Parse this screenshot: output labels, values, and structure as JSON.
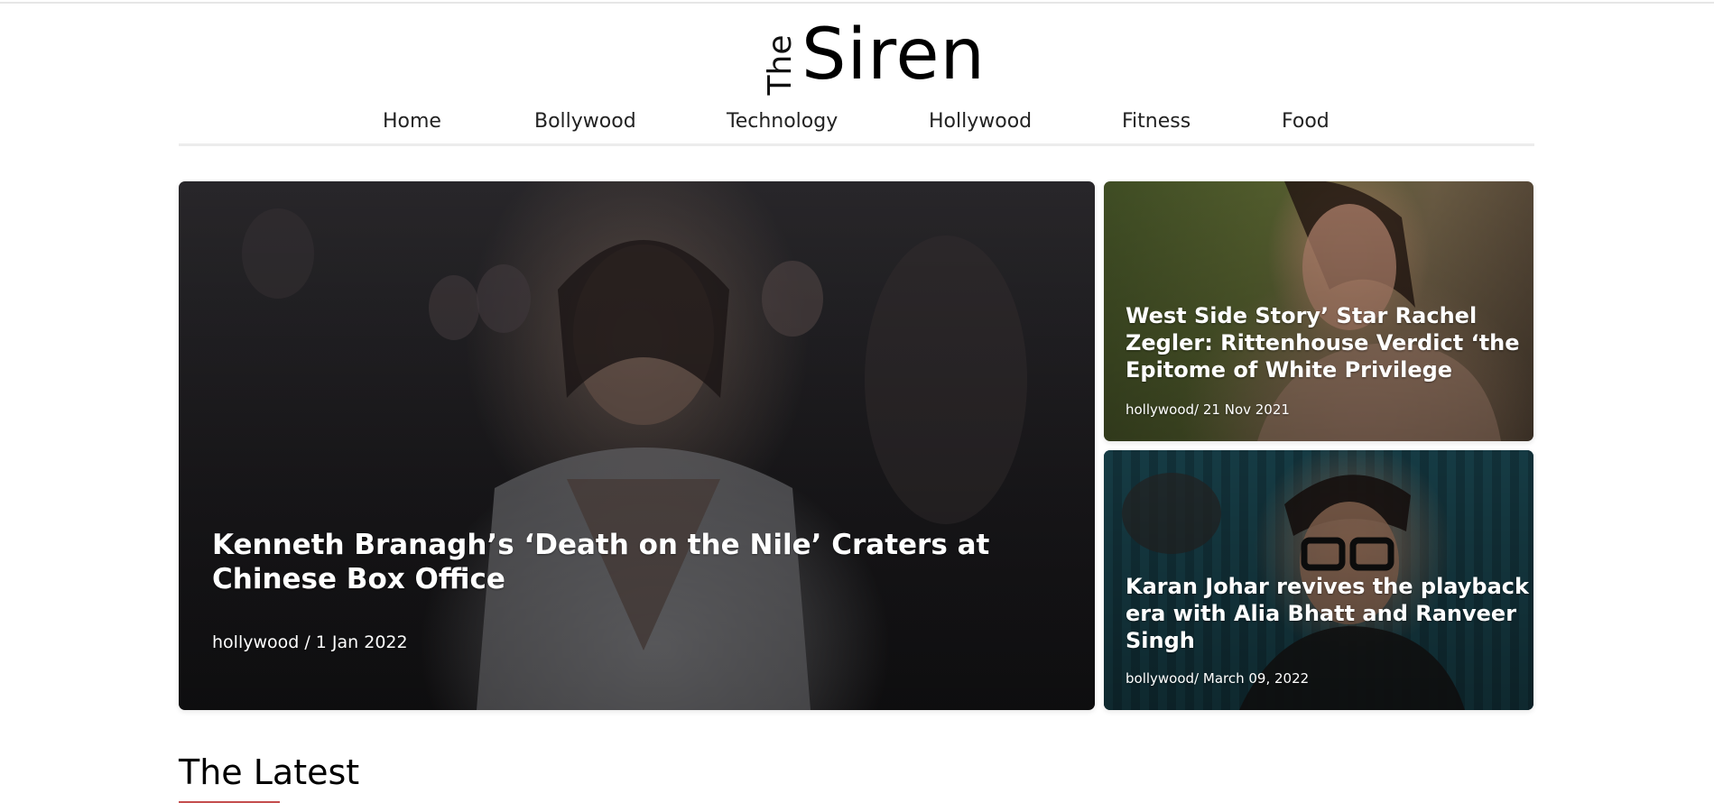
{
  "brand": {
    "prefix": "The",
    "name": "Siren"
  },
  "nav": {
    "items": [
      {
        "label": "Home"
      },
      {
        "label": "Bollywood"
      },
      {
        "label": "Technology"
      },
      {
        "label": "Hollywood"
      },
      {
        "label": "Fitness"
      },
      {
        "label": "Food"
      }
    ]
  },
  "featured": {
    "main": {
      "title": "Kenneth Branagh’s ‘Death on the Nile’ Craters at Chinese Box Office",
      "meta": "hollywood / 1 Jan 2022"
    },
    "side": [
      {
        "title": "West Side Story’ Star Rachel Zegler: Rittenhouse Verdict ‘the Epitome of White Privilege",
        "meta": "hollywood/ 21 Nov 2021"
      },
      {
        "title": "Karan Johar revives the playback era with Alia Bhatt and Ranveer Singh",
        "meta": "bollywood/ March 09, 2022"
      }
    ]
  },
  "latest": {
    "title": "The Latest"
  },
  "colors": {
    "accent_underline": "#c44c4c",
    "nav_divider": "#ececec",
    "text": "#222222"
  }
}
